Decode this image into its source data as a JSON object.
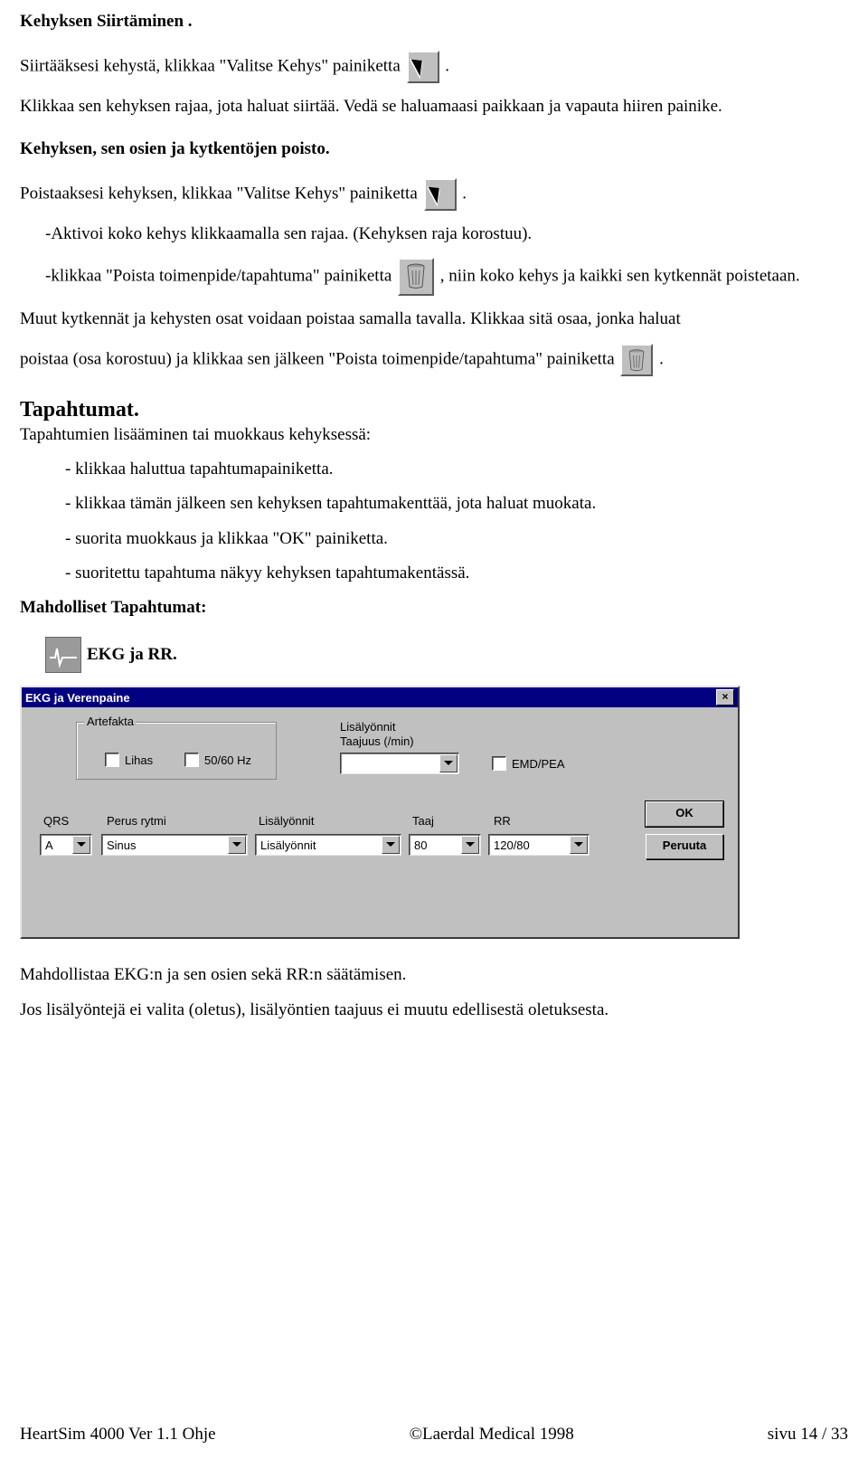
{
  "sections": {
    "siirtaminen_title": "Kehyksen Siirtäminen .",
    "siirtaminen_p1_a": "Siirtääksesi kehystä, klikkaa \"Valitse Kehys\" painiketta ",
    "siirtaminen_p1_b": ".",
    "siirtaminen_p2": "Klikkaa sen kehyksen rajaa, jota haluat siirtää. Vedä se haluamaasi paikkaan ja vapauta hiiren painike.",
    "poisto_title": "Kehyksen, sen osien ja kytkentöjen poisto.",
    "poisto_p1_a": "Poistaaksesi kehyksen, klikkaa \"Valitse Kehys\" painiketta ",
    "poisto_p1_b": ".",
    "poisto_p2": "-Aktivoi koko kehys klikkaamalla sen rajaa. (Kehyksen raja korostuu).",
    "poisto_p3_a": "-klikkaa \"Poista toimenpide/tapahtuma\" painiketta ",
    "poisto_p3_b": ", niin koko kehys ja kaikki sen kytkennät poistetaan.",
    "poisto_p4": "Muut kytkennät ja kehysten osat voidaan poistaa samalla tavalla. Klikkaa sitä osaa, jonka haluat",
    "poisto_p5_a": "poistaa (osa korostuu) ja klikkaa sen jälkeen \"Poista toimenpide/tapahtuma\" painiketta ",
    "poisto_p5_b": ".",
    "tapahtumat_title": "Tapahtumat.",
    "tapahtumat_intro": "Tapahtumien lisääminen tai muokkaus kehyksessä:",
    "tapahtumat_list": [
      "- klikkaa haluttua tapahtumapainiketta.",
      "- klikkaa tämän jälkeen sen kehyksen tapahtumakenttää, jota haluat muokata.",
      "- suorita muokkaus ja klikkaa \"OK\" painiketta.",
      "- suoritettu tapahtuma näkyy kehyksen tapahtumakentässä."
    ],
    "mahdolliset_title": "Mahdolliset Tapahtumat:",
    "ekg_title": "EKG ja RR.",
    "ekg_desc1": "Mahdollistaa EKG:n ja sen osien sekä RR:n säätämisen.",
    "ekg_desc2": "Jos lisälyöntejä ei valita (oletus), lisälyöntien taajuus ei muutu edellisestä oletuksesta."
  },
  "dialog": {
    "title": "EKG ja Verenpaine",
    "artefakta_label": "Artefakta",
    "lihas_label": "Lihas",
    "hz_label": "50/60 Hz",
    "lisalyonnit_top": "Lisälyönnit",
    "taajuus_top": "Taajuus (/min)",
    "emd_label": "EMD/PEA",
    "qrs_label": "QRS",
    "perus_label": "Perus rytmi",
    "lisalyonnit_label": "Lisälyönnit",
    "taaj_label": "Taaj",
    "rr_label": "RR",
    "qrs_value": "A",
    "perus_value": "Sinus",
    "lisalyonnit_value": "Lisälyönnit",
    "taaj_value": "80",
    "rr_value": "120/80",
    "lisalyonnit_top_value": "",
    "ok_btn": "OK",
    "cancel_btn": "Peruuta"
  },
  "footer": {
    "left": "HeartSim 4000 Ver 1.1 Ohje",
    "center": "©Laerdal Medical 1998",
    "right": "sivu 14 / 33"
  }
}
